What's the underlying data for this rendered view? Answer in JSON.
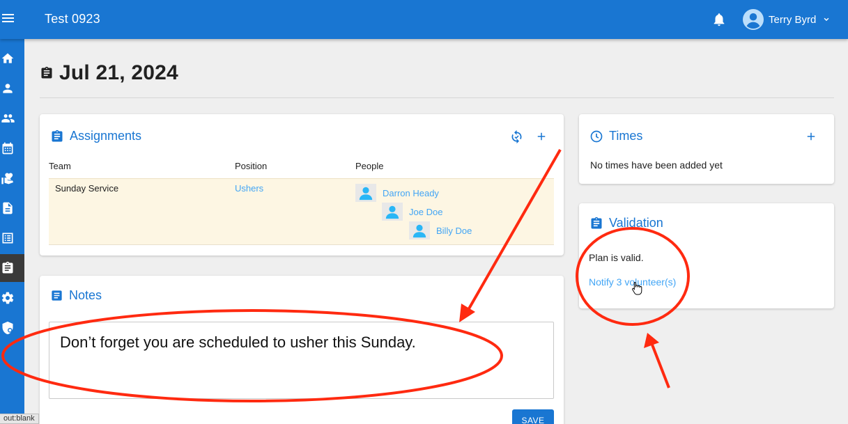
{
  "app": {
    "title": "Test 0923"
  },
  "user": {
    "name": "Terry Byrd"
  },
  "icons": {
    "menu": "hamburger-menu-icon",
    "notifications": "bell-icon",
    "sidebar": [
      "home-icon",
      "person-icon",
      "people-icon",
      "calendar-icon",
      "donation-hand-heart-icon",
      "document-icon",
      "list-icon",
      "clipboard-icon",
      "gear-icon",
      "admin-shield-icon"
    ]
  },
  "colors": {
    "primary": "#1976d2",
    "link": "#42a5f5",
    "highlight_row": "#fdf6e3",
    "annotation": "#ff2a10"
  },
  "page": {
    "title": "Jul 21, 2024"
  },
  "assignments": {
    "title": "Assignments",
    "columns": {
      "team": "Team",
      "position": "Position",
      "people": "People"
    },
    "rows": [
      {
        "team": "Sunday Service",
        "position": "Ushers",
        "people": [
          "Darron Heady",
          "Joe Doe",
          "Billy Doe"
        ]
      }
    ]
  },
  "notes": {
    "title": "Notes",
    "value": "Don’t forget you are scheduled to usher this Sunday.",
    "save_label": "SAVE"
  },
  "times": {
    "title": "Times",
    "empty_text": "No times have been added yet"
  },
  "validation": {
    "title": "Validation",
    "status": "Plan is valid.",
    "notify_link": "Notify 3 volunteer(s)"
  },
  "status_tip": "out:blank"
}
